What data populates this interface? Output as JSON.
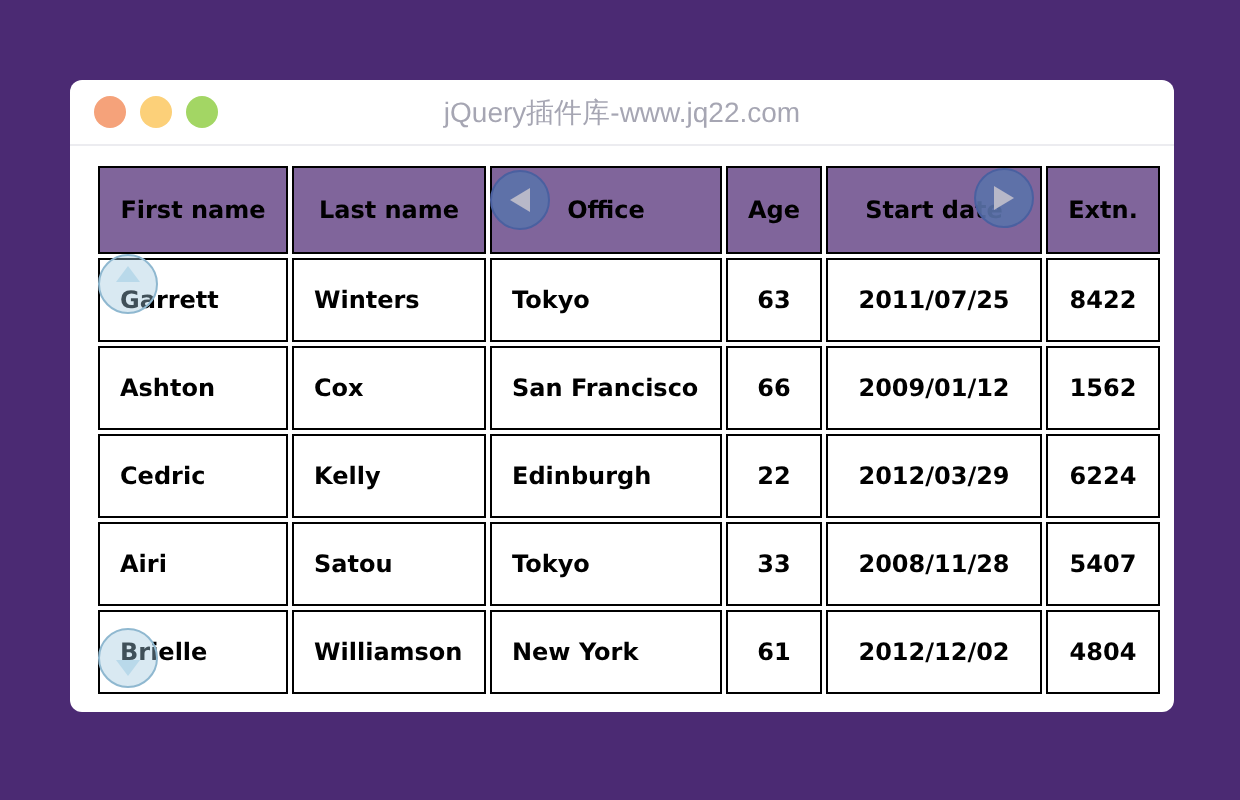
{
  "window": {
    "title": "jQuery插件库-www.jq22.com"
  },
  "table": {
    "columns": [
      "First name",
      "Last name",
      "Office",
      "Age",
      "Start date",
      "Extn."
    ],
    "rows": [
      [
        "Garrett",
        "Winters",
        "Tokyo",
        "63",
        "2011/07/25",
        "8422"
      ],
      [
        "Ashton",
        "Cox",
        "San Francisco",
        "66",
        "2009/01/12",
        "1562"
      ],
      [
        "Cedric",
        "Kelly",
        "Edinburgh",
        "22",
        "2012/03/29",
        "6224"
      ],
      [
        "Airi",
        "Satou",
        "Tokyo",
        "33",
        "2008/11/28",
        "5407"
      ],
      [
        "Brielle",
        "Williamson",
        "New York",
        "61",
        "2012/12/02",
        "4804"
      ]
    ]
  }
}
